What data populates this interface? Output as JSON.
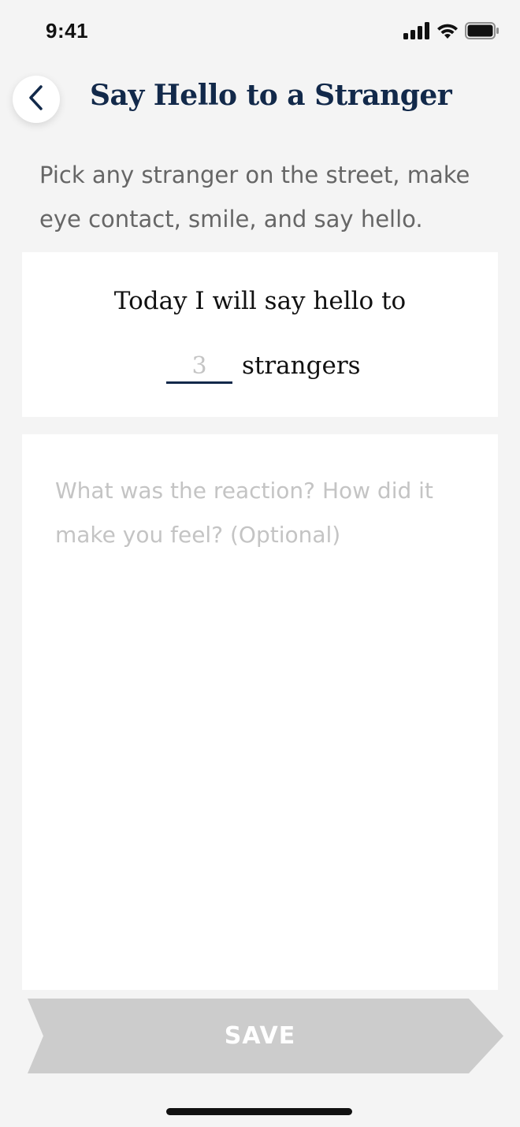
{
  "status_bar": {
    "time": "9:41",
    "icons": [
      "signal-icon",
      "wifi-icon",
      "battery-icon"
    ]
  },
  "header": {
    "back_icon": "chevron-left-icon",
    "title": "Say Hello to a Stranger"
  },
  "description": "Pick any stranger on the street, make eye contact, smile, and say hello.",
  "commitment": {
    "lead_text": "Today I will say hello to",
    "count_placeholder": "3",
    "unit_text": "strangers"
  },
  "notes": {
    "placeholder": "What was the reaction? How did it make you feel? (Optional)"
  },
  "save_button": {
    "label": "SAVE"
  },
  "colors": {
    "background": "#f4f4f4",
    "title": "#12294a",
    "description": "#666666",
    "placeholder": "#c4c4c4",
    "save_button_disabled": "#cccccc"
  }
}
